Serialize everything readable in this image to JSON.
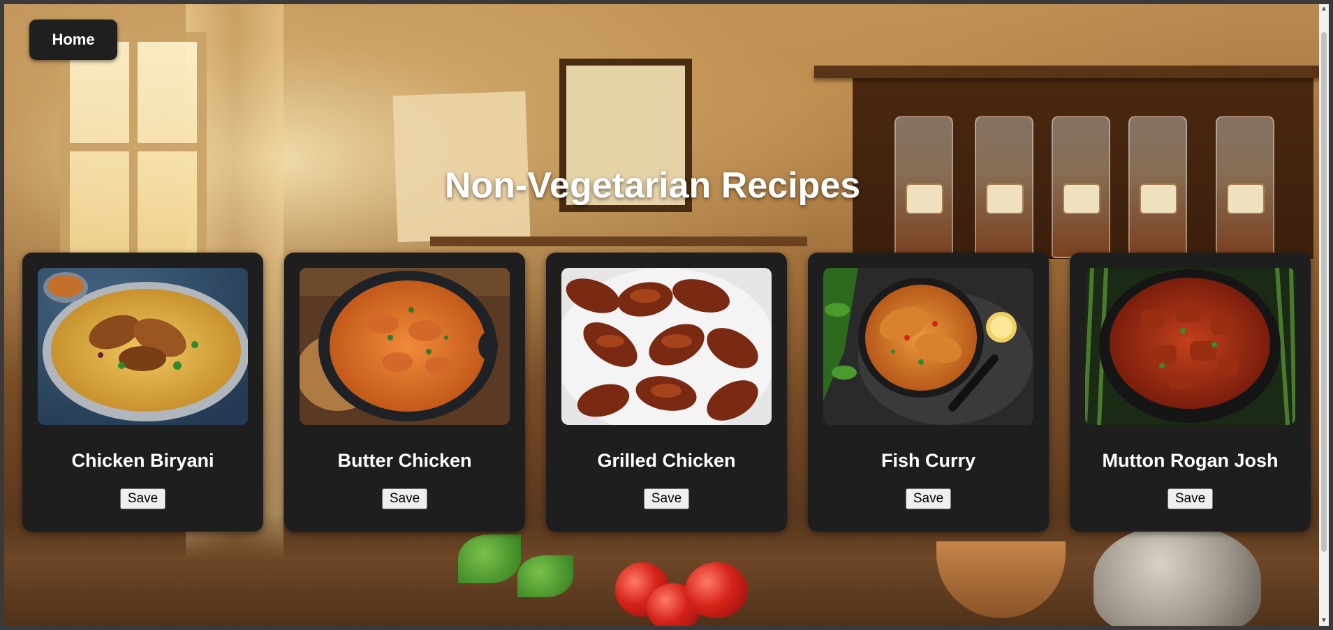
{
  "nav": {
    "home_label": "Home"
  },
  "page": {
    "title": "Non-Vegetarian Recipes"
  },
  "recipes": [
    {
      "name": "Chicken Biryani",
      "save_label": "Save",
      "image": "chicken-biryani-image"
    },
    {
      "name": "Butter Chicken",
      "save_label": "Save",
      "image": "butter-chicken-image"
    },
    {
      "name": "Grilled Chicken",
      "save_label": "Save",
      "image": "grilled-chicken-image"
    },
    {
      "name": "Fish Curry",
      "save_label": "Save",
      "image": "fish-curry-image"
    },
    {
      "name": "Mutton Rogan Josh",
      "save_label": "Save",
      "image": "mutton-rogan-josh-image"
    }
  ],
  "colors": {
    "card_bg": "#1e1e1e",
    "title_text": "#ffffff",
    "home_button_bg": "#1f1f1f"
  }
}
